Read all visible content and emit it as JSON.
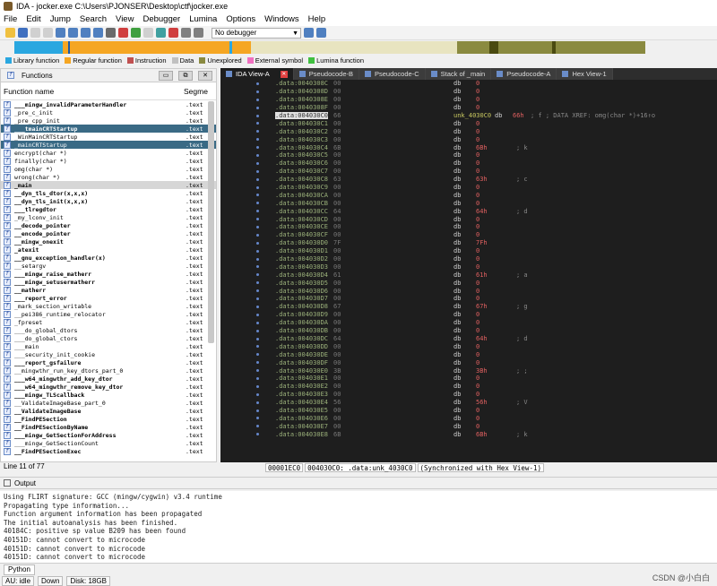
{
  "window": {
    "title": "IDA - jocker.exe C:\\Users\\PJONSER\\Desktop\\ctf\\jocker.exe"
  },
  "menu": [
    "File",
    "Edit",
    "Jump",
    "Search",
    "View",
    "Debugger",
    "Lumina",
    "Options",
    "Windows",
    "Help"
  ],
  "toolbar": {
    "debugger_select": "No debugger"
  },
  "legend": [
    {
      "label": "Library function",
      "color": "#2aa7e0"
    },
    {
      "label": "Regular function",
      "color": "#f5a623"
    },
    {
      "label": "Instruction",
      "color": "#c05050"
    },
    {
      "label": "Data",
      "color": "#c0c0c0"
    },
    {
      "label": "Unexplored",
      "color": "#8a8a40"
    },
    {
      "label": "External symbol",
      "color": "#f070c0"
    },
    {
      "label": "Lumina function",
      "color": "#40c040"
    }
  ],
  "functions_panel": {
    "title": "Functions",
    "col_name": "Function name",
    "col_seg": "Segme",
    "line_info": "Line 11 of 77",
    "rows": [
      {
        "name": "___mingw_invalidParameterHandler",
        "seg": ".text",
        "b": true
      },
      {
        "name": "_pre_c_init",
        "seg": ".text",
        "b": false
      },
      {
        "name": "_pre_cpp_init",
        "seg": ".text",
        "b": false
      },
      {
        "name": "___tmainCRTStartup",
        "seg": ".text",
        "b": true,
        "sel": true
      },
      {
        "name": "_WinMainCRTStartup",
        "seg": ".text",
        "b": false
      },
      {
        "name": "_mainCRTStartup",
        "seg": ".text",
        "b": false,
        "sel": true
      },
      {
        "name": "encrypt(char *)",
        "seg": ".text",
        "b": false
      },
      {
        "name": "finally(char *)",
        "seg": ".text",
        "b": false
      },
      {
        "name": "omg(char *)",
        "seg": ".text",
        "b": false
      },
      {
        "name": "wrong(char *)",
        "seg": ".text",
        "b": false
      },
      {
        "name": "_main",
        "seg": ".text",
        "b": true,
        "gray": true
      },
      {
        "name": "__dyn_tls_dtor(x,x,x)",
        "seg": ".text",
        "b": true
      },
      {
        "name": "__dyn_tls_init(x,x,x)",
        "seg": ".text",
        "b": true
      },
      {
        "name": "___tlregdtor",
        "seg": ".text",
        "b": true
      },
      {
        "name": "_my_lconv_init",
        "seg": ".text",
        "b": false
      },
      {
        "name": "__decode_pointer",
        "seg": ".text",
        "b": true
      },
      {
        "name": "__encode_pointer",
        "seg": ".text",
        "b": true
      },
      {
        "name": "__mingw_onexit",
        "seg": ".text",
        "b": true
      },
      {
        "name": "_atexit",
        "seg": ".text",
        "b": true
      },
      {
        "name": "__gnu_exception_handler(x)",
        "seg": ".text",
        "b": true
      },
      {
        "name": "__setargv",
        "seg": ".text",
        "b": false
      },
      {
        "name": "___mingw_raise_matherr",
        "seg": ".text",
        "b": true
      },
      {
        "name": "___mingw_setusermatherr",
        "seg": ".text",
        "b": true
      },
      {
        "name": "__matherr",
        "seg": ".text",
        "b": true
      },
      {
        "name": "___report_error",
        "seg": ".text",
        "b": true
      },
      {
        "name": "_mark_section_writable",
        "seg": ".text",
        "b": false
      },
      {
        "name": "__pei386_runtime_relocator",
        "seg": ".text",
        "b": false
      },
      {
        "name": "_fpreset",
        "seg": ".text",
        "b": false
      },
      {
        "name": "___do_global_dtors",
        "seg": ".text",
        "b": false
      },
      {
        "name": "___do_global_ctors",
        "seg": ".text",
        "b": false
      },
      {
        "name": "___main",
        "seg": ".text",
        "b": false
      },
      {
        "name": "___security_init_cookie",
        "seg": ".text",
        "b": false
      },
      {
        "name": "___report_gsfailure",
        "seg": ".text",
        "b": true
      },
      {
        "name": "__mingwthr_run_key_dtors_part_0",
        "seg": ".text",
        "b": false
      },
      {
        "name": "___w64_mingwthr_add_key_dtor",
        "seg": ".text",
        "b": true
      },
      {
        "name": "___w64_mingwthr_remove_key_dtor",
        "seg": ".text",
        "b": true
      },
      {
        "name": "___mingw_TLScallback",
        "seg": ".text",
        "b": true
      },
      {
        "name": "__ValidateImageBase_part_0",
        "seg": ".text",
        "b": false
      },
      {
        "name": "__ValidateImageBase",
        "seg": ".text",
        "b": true
      },
      {
        "name": "__FindPESection",
        "seg": ".text",
        "b": true
      },
      {
        "name": "__FindPESectionByName",
        "seg": ".text",
        "b": true
      },
      {
        "name": "___mingw_GetSectionForAddress",
        "seg": ".text",
        "b": true
      },
      {
        "name": "___mingw_GetSectionCount",
        "seg": ".text",
        "b": false
      },
      {
        "name": "__FindPESectionExec",
        "seg": ".text",
        "b": true
      }
    ]
  },
  "tabs": [
    {
      "label": "IDA View-A",
      "active": true,
      "close": true
    },
    {
      "label": "Pseudocode-B",
      "active": false
    },
    {
      "label": "Pseudocode-C",
      "active": false
    },
    {
      "label": "Stack of _main",
      "active": false
    },
    {
      "label": "Pseudocode-A",
      "active": false
    },
    {
      "label": "Hex View-1",
      "active": false
    }
  ],
  "disasm": [
    {
      "adr": ".data:0040308C",
      "ob": "00",
      "mn": "db",
      "vl": "0",
      "cm": ""
    },
    {
      "adr": ".data:0040308D",
      "ob": "00",
      "mn": "db",
      "vl": "0",
      "cm": ""
    },
    {
      "adr": ".data:0040308E",
      "ob": "00",
      "mn": "db",
      "vl": "0",
      "cm": ""
    },
    {
      "adr": ".data:0040308F",
      "ob": "00",
      "mn": "db",
      "vl": "0",
      "cm": ""
    },
    {
      "adr": ".data:004030C0",
      "ob": "66",
      "lbl": "unk_4030C0",
      "mn": "db",
      "vl": "66h",
      "cm": "; f           ; DATA XREF: omg(char *)+16↑o",
      "cur": true
    },
    {
      "adr": ".data:004030C1",
      "ob": "00",
      "mn": "db",
      "vl": "0",
      "cm": ""
    },
    {
      "adr": ".data:004030C2",
      "ob": "00",
      "mn": "db",
      "vl": "0",
      "cm": ""
    },
    {
      "adr": ".data:004030C3",
      "ob": "00",
      "mn": "db",
      "vl": "0",
      "cm": ""
    },
    {
      "adr": ".data:004030C4",
      "ob": "6B",
      "mn": "db",
      "vl": "6Bh",
      "cm": "; k"
    },
    {
      "adr": ".data:004030C5",
      "ob": "00",
      "mn": "db",
      "vl": "0",
      "cm": ""
    },
    {
      "adr": ".data:004030C6",
      "ob": "00",
      "mn": "db",
      "vl": "0",
      "cm": ""
    },
    {
      "adr": ".data:004030C7",
      "ob": "00",
      "mn": "db",
      "vl": "0",
      "cm": ""
    },
    {
      "adr": ".data:004030C8",
      "ob": "63",
      "mn": "db",
      "vl": "63h",
      "cm": "; c"
    },
    {
      "adr": ".data:004030C9",
      "ob": "00",
      "mn": "db",
      "vl": "0",
      "cm": ""
    },
    {
      "adr": ".data:004030CA",
      "ob": "00",
      "mn": "db",
      "vl": "0",
      "cm": ""
    },
    {
      "adr": ".data:004030CB",
      "ob": "00",
      "mn": "db",
      "vl": "0",
      "cm": ""
    },
    {
      "adr": ".data:004030CC",
      "ob": "64",
      "mn": "db",
      "vl": "64h",
      "cm": "; d"
    },
    {
      "adr": ".data:004030CD",
      "ob": "00",
      "mn": "db",
      "vl": "0",
      "cm": ""
    },
    {
      "adr": ".data:004030CE",
      "ob": "00",
      "mn": "db",
      "vl": "0",
      "cm": ""
    },
    {
      "adr": ".data:004030CF",
      "ob": "00",
      "mn": "db",
      "vl": "0",
      "cm": ""
    },
    {
      "adr": ".data:004030D0",
      "ob": "7F",
      "mn": "db",
      "vl": "7Fh",
      "cm": ""
    },
    {
      "adr": ".data:004030D1",
      "ob": "00",
      "mn": "db",
      "vl": "0",
      "cm": ""
    },
    {
      "adr": ".data:004030D2",
      "ob": "00",
      "mn": "db",
      "vl": "0",
      "cm": ""
    },
    {
      "adr": ".data:004030D3",
      "ob": "00",
      "mn": "db",
      "vl": "0",
      "cm": ""
    },
    {
      "adr": ".data:004030D4",
      "ob": "61",
      "mn": "db",
      "vl": "61h",
      "cm": "; a"
    },
    {
      "adr": ".data:004030D5",
      "ob": "00",
      "mn": "db",
      "vl": "0",
      "cm": ""
    },
    {
      "adr": ".data:004030D6",
      "ob": "00",
      "mn": "db",
      "vl": "0",
      "cm": ""
    },
    {
      "adr": ".data:004030D7",
      "ob": "00",
      "mn": "db",
      "vl": "0",
      "cm": ""
    },
    {
      "adr": ".data:004030D8",
      "ob": "67",
      "mn": "db",
      "vl": "67h",
      "cm": "; g"
    },
    {
      "adr": ".data:004030D9",
      "ob": "00",
      "mn": "db",
      "vl": "0",
      "cm": ""
    },
    {
      "adr": ".data:004030DA",
      "ob": "00",
      "mn": "db",
      "vl": "0",
      "cm": ""
    },
    {
      "adr": ".data:004030DB",
      "ob": "00",
      "mn": "db",
      "vl": "0",
      "cm": ""
    },
    {
      "adr": ".data:004030DC",
      "ob": "64",
      "mn": "db",
      "vl": "64h",
      "cm": "; d"
    },
    {
      "adr": ".data:004030DD",
      "ob": "00",
      "mn": "db",
      "vl": "0",
      "cm": ""
    },
    {
      "adr": ".data:004030DE",
      "ob": "00",
      "mn": "db",
      "vl": "0",
      "cm": ""
    },
    {
      "adr": ".data:004030DF",
      "ob": "00",
      "mn": "db",
      "vl": "0",
      "cm": ""
    },
    {
      "adr": ".data:004030E0",
      "ob": "3B",
      "mn": "db",
      "vl": "3Bh",
      "cm": "; ;"
    },
    {
      "adr": ".data:004030E1",
      "ob": "00",
      "mn": "db",
      "vl": "0",
      "cm": ""
    },
    {
      "adr": ".data:004030E2",
      "ob": "00",
      "mn": "db",
      "vl": "0",
      "cm": ""
    },
    {
      "adr": ".data:004030E3",
      "ob": "00",
      "mn": "db",
      "vl": "0",
      "cm": ""
    },
    {
      "adr": ".data:004030E4",
      "ob": "56",
      "mn": "db",
      "vl": "56h",
      "cm": "; V"
    },
    {
      "adr": ".data:004030E5",
      "ob": "00",
      "mn": "db",
      "vl": "0",
      "cm": ""
    },
    {
      "adr": ".data:004030E6",
      "ob": "00",
      "mn": "db",
      "vl": "0",
      "cm": ""
    },
    {
      "adr": ".data:004030E7",
      "ob": "00",
      "mn": "db",
      "vl": "0",
      "cm": ""
    },
    {
      "adr": ".data:004030E8",
      "ob": "6B",
      "mn": "db",
      "vl": "6Bh",
      "cm": "; k"
    }
  ],
  "status_line": {
    "a": "00001EC0",
    "b": "004030C0: .data:unk_4030C0",
    "c": "(Synchronized with Hex View-1)"
  },
  "output": {
    "title": "Output",
    "lines": [
      "Using FLIRT signature: GCC (mingw/cygwin) v3.4 runtime",
      "Propagating type information...",
      "Function argument information has been propagated",
      "The initial autoanalysis has been finished.",
      "40184C: positive sp value B209 has been found",
      "40151D: cannot convert to microcode",
      "40151D: cannot convert to microcode",
      "40151D: cannot convert to microcode"
    ],
    "python_tab": "Python"
  },
  "statusbar": {
    "au": "AU:  idle",
    "dir": "Down",
    "disk": "Disk: 18GB"
  },
  "watermark": "CSDN @小白白"
}
